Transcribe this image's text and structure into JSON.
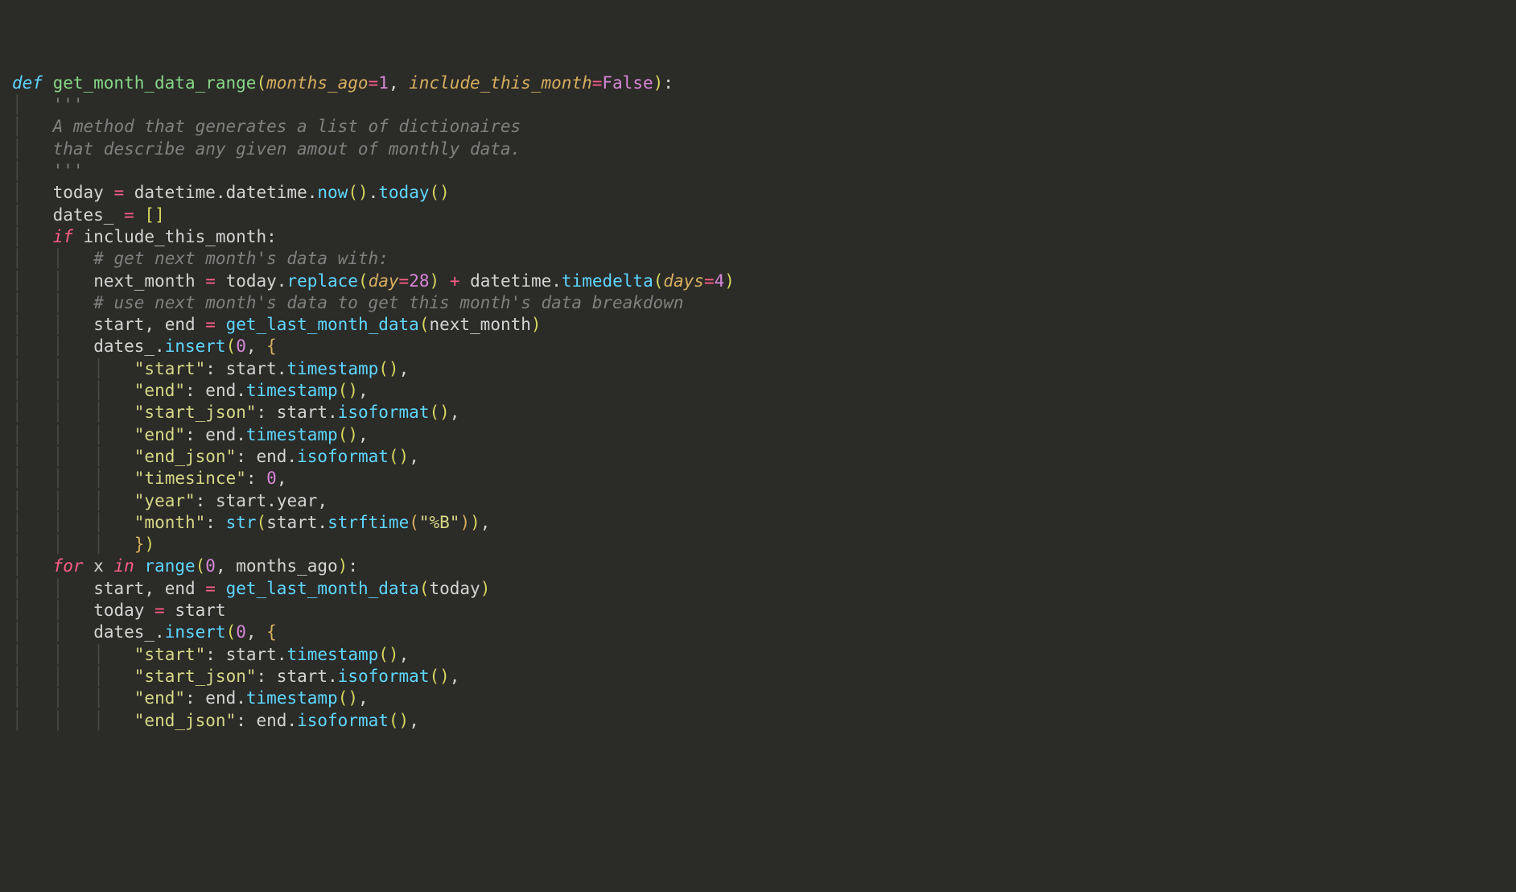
{
  "code": {
    "lines": [
      {
        "indent": 0,
        "tokens": [
          {
            "t": "def ",
            "c": "def"
          },
          {
            "t": "get_month_data_range",
            "c": "fn"
          },
          {
            "t": "(",
            "c": "yellow"
          },
          {
            "t": "months_ago",
            "c": "param"
          },
          {
            "t": "=",
            "c": "op"
          },
          {
            "t": "1",
            "c": "num"
          },
          {
            "t": ", ",
            "c": "punct"
          },
          {
            "t": "include_this_month",
            "c": "param"
          },
          {
            "t": "=",
            "c": "op"
          },
          {
            "t": "False",
            "c": "bool"
          },
          {
            "t": ")",
            "c": "yellow"
          },
          {
            "t": ":",
            "c": "punct"
          }
        ]
      },
      {
        "indent": 1,
        "tokens": [
          {
            "t": "'''",
            "c": "comment"
          }
        ]
      },
      {
        "indent": 1,
        "tokens": [
          {
            "t": "A method that generates a list of dictionaires",
            "c": "comment"
          }
        ]
      },
      {
        "indent": 1,
        "tokens": [
          {
            "t": "that describe any given amout of monthly data.",
            "c": "comment"
          }
        ]
      },
      {
        "indent": 1,
        "tokens": [
          {
            "t": "'''",
            "c": "comment"
          }
        ]
      },
      {
        "indent": 1,
        "tokens": [
          {
            "t": "today ",
            "c": "ident"
          },
          {
            "t": "=",
            "c": "op"
          },
          {
            "t": " datetime",
            "c": "ident"
          },
          {
            "t": ".",
            "c": "punct"
          },
          {
            "t": "datetime",
            "c": "ident"
          },
          {
            "t": ".",
            "c": "punct"
          },
          {
            "t": "now",
            "c": "call"
          },
          {
            "t": "()",
            "c": "yellow"
          },
          {
            "t": ".",
            "c": "punct"
          },
          {
            "t": "today",
            "c": "call"
          },
          {
            "t": "()",
            "c": "yellow"
          }
        ]
      },
      {
        "indent": 1,
        "tokens": [
          {
            "t": "dates_ ",
            "c": "ident"
          },
          {
            "t": "=",
            "c": "op"
          },
          {
            "t": " ",
            "c": "ident"
          },
          {
            "t": "[]",
            "c": "yellow"
          }
        ]
      },
      {
        "indent": 1,
        "tokens": [
          {
            "t": "if ",
            "c": "kw"
          },
          {
            "t": "include_this_month",
            "c": "ident"
          },
          {
            "t": ":",
            "c": "punct"
          }
        ]
      },
      {
        "indent": 2,
        "tokens": [
          {
            "t": "# get next month's data with:",
            "c": "comment"
          }
        ]
      },
      {
        "indent": 2,
        "tokens": [
          {
            "t": "next_month ",
            "c": "ident"
          },
          {
            "t": "=",
            "c": "op"
          },
          {
            "t": " today",
            "c": "ident"
          },
          {
            "t": ".",
            "c": "punct"
          },
          {
            "t": "replace",
            "c": "call"
          },
          {
            "t": "(",
            "c": "yellow"
          },
          {
            "t": "day",
            "c": "param"
          },
          {
            "t": "=",
            "c": "op"
          },
          {
            "t": "28",
            "c": "num"
          },
          {
            "t": ")",
            "c": "yellow"
          },
          {
            "t": " ",
            "c": "ident"
          },
          {
            "t": "+",
            "c": "op"
          },
          {
            "t": " datetime",
            "c": "ident"
          },
          {
            "t": ".",
            "c": "punct"
          },
          {
            "t": "timedelta",
            "c": "call"
          },
          {
            "t": "(",
            "c": "yellow"
          },
          {
            "t": "days",
            "c": "param"
          },
          {
            "t": "=",
            "c": "op"
          },
          {
            "t": "4",
            "c": "num"
          },
          {
            "t": ")",
            "c": "yellow"
          }
        ]
      },
      {
        "indent": 2,
        "tokens": [
          {
            "t": "# use next month's data to get this month's data breakdown",
            "c": "comment"
          }
        ]
      },
      {
        "indent": 2,
        "tokens": [
          {
            "t": "start",
            "c": "ident"
          },
          {
            "t": ", ",
            "c": "punct"
          },
          {
            "t": "end ",
            "c": "ident"
          },
          {
            "t": "=",
            "c": "op"
          },
          {
            "t": " ",
            "c": "ident"
          },
          {
            "t": "get_last_month_data",
            "c": "call"
          },
          {
            "t": "(",
            "c": "yellow"
          },
          {
            "t": "next_month",
            "c": "ident"
          },
          {
            "t": ")",
            "c": "yellow"
          }
        ]
      },
      {
        "indent": 2,
        "tokens": [
          {
            "t": "dates_",
            "c": "ident"
          },
          {
            "t": ".",
            "c": "punct"
          },
          {
            "t": "insert",
            "c": "call"
          },
          {
            "t": "(",
            "c": "yellow"
          },
          {
            "t": "0",
            "c": "num"
          },
          {
            "t": ", ",
            "c": "punct"
          },
          {
            "t": "{",
            "c": "gold"
          }
        ]
      },
      {
        "indent": 3,
        "tokens": [
          {
            "t": "\"start\"",
            "c": "str"
          },
          {
            "t": ": ",
            "c": "punct"
          },
          {
            "t": "start",
            "c": "ident"
          },
          {
            "t": ".",
            "c": "punct"
          },
          {
            "t": "timestamp",
            "c": "call"
          },
          {
            "t": "()",
            "c": "yellow"
          },
          {
            "t": ",",
            "c": "punct"
          }
        ]
      },
      {
        "indent": 3,
        "tokens": [
          {
            "t": "\"end\"",
            "c": "str"
          },
          {
            "t": ": ",
            "c": "punct"
          },
          {
            "t": "end",
            "c": "ident"
          },
          {
            "t": ".",
            "c": "punct"
          },
          {
            "t": "timestamp",
            "c": "call"
          },
          {
            "t": "()",
            "c": "yellow"
          },
          {
            "t": ",",
            "c": "punct"
          }
        ]
      },
      {
        "indent": 3,
        "tokens": [
          {
            "t": "\"start_json\"",
            "c": "str"
          },
          {
            "t": ": ",
            "c": "punct"
          },
          {
            "t": "start",
            "c": "ident"
          },
          {
            "t": ".",
            "c": "punct"
          },
          {
            "t": "isoformat",
            "c": "call"
          },
          {
            "t": "()",
            "c": "yellow"
          },
          {
            "t": ",",
            "c": "punct"
          }
        ]
      },
      {
        "indent": 3,
        "tokens": [
          {
            "t": "\"end\"",
            "c": "str"
          },
          {
            "t": ": ",
            "c": "punct"
          },
          {
            "t": "end",
            "c": "ident"
          },
          {
            "t": ".",
            "c": "punct"
          },
          {
            "t": "timestamp",
            "c": "call"
          },
          {
            "t": "()",
            "c": "yellow"
          },
          {
            "t": ",",
            "c": "punct"
          }
        ]
      },
      {
        "indent": 3,
        "tokens": [
          {
            "t": "\"end_json\"",
            "c": "str"
          },
          {
            "t": ": ",
            "c": "punct"
          },
          {
            "t": "end",
            "c": "ident"
          },
          {
            "t": ".",
            "c": "punct"
          },
          {
            "t": "isoformat",
            "c": "call"
          },
          {
            "t": "()",
            "c": "yellow"
          },
          {
            "t": ",",
            "c": "punct"
          }
        ]
      },
      {
        "indent": 3,
        "tokens": [
          {
            "t": "\"timesince\"",
            "c": "str"
          },
          {
            "t": ": ",
            "c": "punct"
          },
          {
            "t": "0",
            "c": "num"
          },
          {
            "t": ",",
            "c": "punct"
          }
        ]
      },
      {
        "indent": 3,
        "tokens": [
          {
            "t": "\"year\"",
            "c": "str"
          },
          {
            "t": ": ",
            "c": "punct"
          },
          {
            "t": "start",
            "c": "ident"
          },
          {
            "t": ".",
            "c": "punct"
          },
          {
            "t": "year",
            "c": "ident"
          },
          {
            "t": ",",
            "c": "punct"
          }
        ]
      },
      {
        "indent": 3,
        "tokens": [
          {
            "t": "\"month\"",
            "c": "str"
          },
          {
            "t": ": ",
            "c": "punct"
          },
          {
            "t": "str",
            "c": "call"
          },
          {
            "t": "(",
            "c": "yellow"
          },
          {
            "t": "start",
            "c": "ident"
          },
          {
            "t": ".",
            "c": "punct"
          },
          {
            "t": "strftime",
            "c": "call"
          },
          {
            "t": "(",
            "c": "gold"
          },
          {
            "t": "\"%B\"",
            "c": "str"
          },
          {
            "t": ")",
            "c": "gold"
          },
          {
            "t": ")",
            "c": "yellow"
          },
          {
            "t": ",",
            "c": "punct"
          }
        ]
      },
      {
        "indent": 3,
        "tokens": [
          {
            "t": "}",
            "c": "gold"
          },
          {
            "t": ")",
            "c": "yellow"
          }
        ]
      },
      {
        "indent": 1,
        "tokens": [
          {
            "t": "for ",
            "c": "kw"
          },
          {
            "t": "x ",
            "c": "ident"
          },
          {
            "t": "in ",
            "c": "kw"
          },
          {
            "t": "range",
            "c": "call"
          },
          {
            "t": "(",
            "c": "yellow"
          },
          {
            "t": "0",
            "c": "num"
          },
          {
            "t": ", ",
            "c": "punct"
          },
          {
            "t": "months_ago",
            "c": "ident"
          },
          {
            "t": ")",
            "c": "yellow"
          },
          {
            "t": ":",
            "c": "punct"
          }
        ]
      },
      {
        "indent": 2,
        "tokens": [
          {
            "t": "start",
            "c": "ident"
          },
          {
            "t": ", ",
            "c": "punct"
          },
          {
            "t": "end ",
            "c": "ident"
          },
          {
            "t": "=",
            "c": "op"
          },
          {
            "t": " ",
            "c": "ident"
          },
          {
            "t": "get_last_month_data",
            "c": "call"
          },
          {
            "t": "(",
            "c": "yellow"
          },
          {
            "t": "today",
            "c": "ident"
          },
          {
            "t": ")",
            "c": "yellow"
          }
        ]
      },
      {
        "indent": 2,
        "tokens": [
          {
            "t": "today ",
            "c": "ident"
          },
          {
            "t": "=",
            "c": "op"
          },
          {
            "t": " start",
            "c": "ident"
          }
        ]
      },
      {
        "indent": 2,
        "tokens": [
          {
            "t": "dates_",
            "c": "ident"
          },
          {
            "t": ".",
            "c": "punct"
          },
          {
            "t": "insert",
            "c": "call"
          },
          {
            "t": "(",
            "c": "yellow"
          },
          {
            "t": "0",
            "c": "num"
          },
          {
            "t": ", ",
            "c": "punct"
          },
          {
            "t": "{",
            "c": "gold"
          }
        ]
      },
      {
        "indent": 3,
        "tokens": [
          {
            "t": "\"start\"",
            "c": "str"
          },
          {
            "t": ": ",
            "c": "punct"
          },
          {
            "t": "start",
            "c": "ident"
          },
          {
            "t": ".",
            "c": "punct"
          },
          {
            "t": "timestamp",
            "c": "call"
          },
          {
            "t": "()",
            "c": "yellow"
          },
          {
            "t": ",",
            "c": "punct"
          }
        ]
      },
      {
        "indent": 3,
        "tokens": [
          {
            "t": "\"start_json\"",
            "c": "str"
          },
          {
            "t": ": ",
            "c": "punct"
          },
          {
            "t": "start",
            "c": "ident"
          },
          {
            "t": ".",
            "c": "punct"
          },
          {
            "t": "isoformat",
            "c": "call"
          },
          {
            "t": "()",
            "c": "yellow"
          },
          {
            "t": ",",
            "c": "punct"
          }
        ]
      },
      {
        "indent": 3,
        "tokens": [
          {
            "t": "\"end\"",
            "c": "str"
          },
          {
            "t": ": ",
            "c": "punct"
          },
          {
            "t": "end",
            "c": "ident"
          },
          {
            "t": ".",
            "c": "punct"
          },
          {
            "t": "timestamp",
            "c": "call"
          },
          {
            "t": "()",
            "c": "yellow"
          },
          {
            "t": ",",
            "c": "punct"
          }
        ]
      },
      {
        "indent": 3,
        "tokens": [
          {
            "t": "\"end_json\"",
            "c": "str"
          },
          {
            "t": ": ",
            "c": "punct"
          },
          {
            "t": "end",
            "c": "ident"
          },
          {
            "t": ".",
            "c": "punct"
          },
          {
            "t": "isoformat",
            "c": "call"
          },
          {
            "t": "()",
            "c": "yellow"
          },
          {
            "t": ",",
            "c": "punct"
          }
        ]
      }
    ]
  }
}
